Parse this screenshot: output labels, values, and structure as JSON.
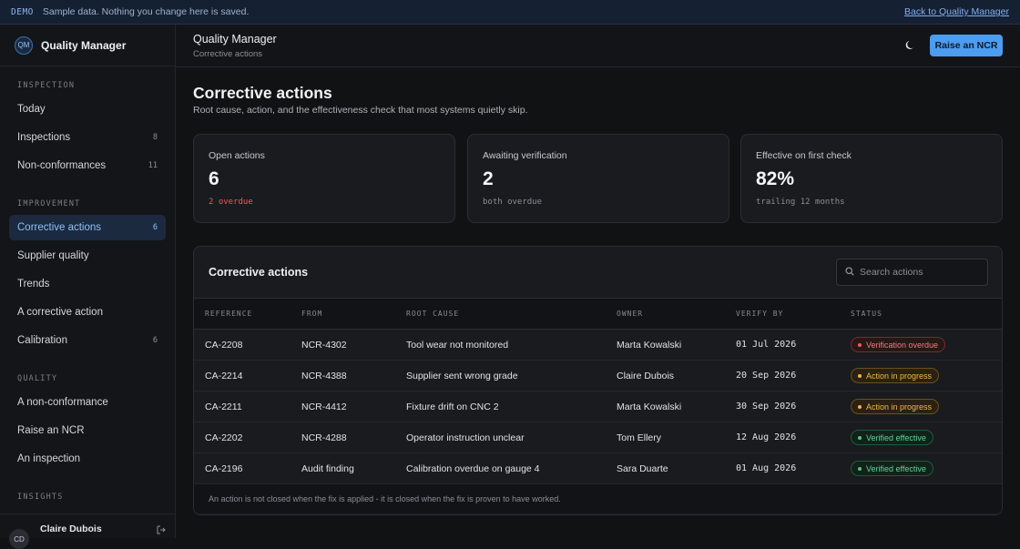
{
  "banner": {
    "tag": "DEMO",
    "message": "Sample data. Nothing you change here is saved.",
    "back_link": "Back to Quality Manager"
  },
  "sidebar": {
    "logo": "QM",
    "app_name": "Quality Manager",
    "sections": [
      {
        "label": "INSPECTION",
        "items": [
          {
            "label": "Today",
            "count": ""
          },
          {
            "label": "Inspections",
            "count": "8"
          },
          {
            "label": "Non-conformances",
            "count": "11"
          }
        ]
      },
      {
        "label": "IMPROVEMENT",
        "items": [
          {
            "label": "Corrective actions",
            "count": "6"
          },
          {
            "label": "Supplier quality",
            "count": ""
          },
          {
            "label": "Trends",
            "count": ""
          },
          {
            "label": "A corrective action",
            "count": ""
          },
          {
            "label": "Calibration",
            "count": "6"
          }
        ]
      },
      {
        "label": "QUALITY",
        "items": [
          {
            "label": "A non-conformance",
            "count": ""
          },
          {
            "label": "Raise an NCR",
            "count": ""
          },
          {
            "label": "An inspection",
            "count": ""
          }
        ]
      },
      {
        "label": "INSIGHTS",
        "items": []
      }
    ],
    "user": {
      "initials": "CD",
      "name": "Claire Dubois"
    }
  },
  "header": {
    "title": "Quality Manager",
    "subtitle": "Corrective actions",
    "primary_button": "Raise an NCR"
  },
  "page": {
    "title": "Corrective actions",
    "subtitle": "Root cause, action, and the effectiveness check that most systems quietly skip."
  },
  "stats": [
    {
      "label": "Open actions",
      "value": "6",
      "note": "2 overdue",
      "alert": true
    },
    {
      "label": "Awaiting verification",
      "value": "2",
      "note": "both overdue",
      "alert": false
    },
    {
      "label": "Effective on first check",
      "value": "82%",
      "note": "trailing 12 months",
      "alert": false
    }
  ],
  "table": {
    "title": "Corrective actions",
    "search_placeholder": "Search actions",
    "columns": [
      "REFERENCE",
      "FROM",
      "ROOT CAUSE",
      "OWNER",
      "VERIFY BY",
      "STATUS"
    ],
    "rows": [
      {
        "reference": "CA-2208",
        "from": "NCR-4302",
        "root_cause": "Tool wear not monitored",
        "owner": "Marta Kowalski",
        "verify_by": "01 Jul 2026",
        "status": "Verification overdue",
        "tone": "red"
      },
      {
        "reference": "CA-2214",
        "from": "NCR-4388",
        "root_cause": "Supplier sent wrong grade",
        "owner": "Claire Dubois",
        "verify_by": "20 Sep 2026",
        "status": "Action in progress",
        "tone": "amber"
      },
      {
        "reference": "CA-2211",
        "from": "NCR-4412",
        "root_cause": "Fixture drift on CNC 2",
        "owner": "Marta Kowalski",
        "verify_by": "30 Sep 2026",
        "status": "Action in progress",
        "tone": "amber"
      },
      {
        "reference": "CA-2202",
        "from": "NCR-4288",
        "root_cause": "Operator instruction unclear",
        "owner": "Tom Ellery",
        "verify_by": "12 Aug 2026",
        "status": "Verified effective",
        "tone": "green"
      },
      {
        "reference": "CA-2196",
        "from": "Audit finding",
        "root_cause": "Calibration overdue on gauge 4",
        "owner": "Sara Duarte",
        "verify_by": "01 Aug 2026",
        "status": "Verified effective",
        "tone": "green"
      }
    ],
    "footer": "An action is not closed when the fix is applied - it is closed when the fix is proven to have worked."
  },
  "tones": {
    "red": {
      "text": "#f27a7a",
      "border": "#7a2a2a",
      "bg": "#2a1616",
      "dot": "#ef5a5a"
    },
    "amber": {
      "text": "#f0b84a",
      "border": "#6b5020",
      "bg": "#2a2112",
      "dot": "#f0b84a"
    },
    "green": {
      "text": "#5fd39a",
      "border": "#1f5a3d",
      "bg": "#122219",
      "dot": "#4cc88a"
    }
  },
  "colors": {
    "accent": "#4c9cf0",
    "active_nav": "#8ec0f5"
  },
  "active_nav": "Corrective actions"
}
